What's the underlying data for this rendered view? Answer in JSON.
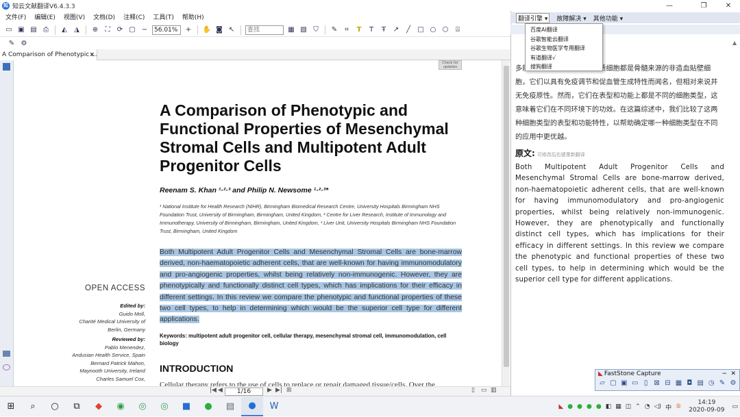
{
  "window": {
    "title": "知云文献翻译V6.4.3.3",
    "app_icon": "知"
  },
  "menu": [
    "文件(F)",
    "编辑(E)",
    "视图(V)",
    "文档(D)",
    "注释(C)",
    "工具(T)",
    "帮助(H)"
  ],
  "toolbar": {
    "zoom": "56.01%",
    "find_placeholder": "查找"
  },
  "tab": {
    "title": "A Comparison of Phenotypic ...",
    "close": "×"
  },
  "paper": {
    "badge": "Check for updates",
    "title": "A Comparison of Phenotypic and Functional Properties of Mesenchymal Stromal Cells and Multipotent Adult Progenitor Cells",
    "authors": "Reenam S. Khan ¹·²·³ and Philip N. Newsome ¹·²·³*",
    "affiliations": "¹ National Institute for Health Research (NIHR), Birmingham Biomedical Research Centre, University Hospitals Birmingham NHS Foundation Trust, University of Birmingham, Birmingham, United Kingdom, ² Centre for Liver Research, Institute of Immunology and Immunotherapy, University of Birmingham, Birmingham, United Kingdom, ³ Liver Unit, University Hospitals Birmingham NHS Foundation Trust, Birmingham, United Kingdom",
    "abstract": "Both Multipotent Adult Progenitor Cells and Mesenchymal Stromal Cells are bone-marrow derived, non-haematopoietic adherent cells, that are well-known for having immunomodulatory and pro-angiogenic properties, whilst being relatively non-immunogenic. However, they are phenotypically and functionally distinct cell types, which has implications for their efficacy in different settings. In this review we compare the phenotypic and functional properties of these two cell types, to help in determining which would be the superior cell type for different applications.",
    "keywords_label": "Keywords:",
    "keywords": "multipotent adult progenitor cell, cellular therapy, mesenchymal stromal cell, immunomodulation, cell biology",
    "intro_heading": "INTRODUCTION",
    "intro_text": "Cellular therapy refers to the use of cells to replace or repair damaged tissue/cells. Over the",
    "open_access": "OPEN ACCESS",
    "edited_by_label": "Edited by:",
    "edited_by": [
      "Guido Moll,",
      "Charité Medical University of",
      "Berlin, Germany"
    ],
    "reviewed_by_label": "Reviewed by:",
    "reviewed_by": [
      "Pablo Menendez,",
      "Andusian Health Service, Spain",
      "Bernard Patrick Mahon,",
      "Maynooth University, Ireland",
      "Charles Samuel Cox,"
    ]
  },
  "status": {
    "page": "1/16"
  },
  "right_panel": {
    "tabs": [
      "翻译引擎 ▾",
      "故障解决 ▾",
      "其他功能 ▾"
    ],
    "engine_menu": [
      "百度AI翻译",
      "谷歌智能云翻译",
      "谷歌生物医学专用翻译",
      "有道翻译√",
      "搜狗翻译"
    ],
    "translation": "多能成体祖细胞和间充质基质细胞都是骨髓来源的非造血贴壁细胞，它们以具有免疫调节和促血管生成特性而闻名，但相对来说并无免疫原性。然而，它们在表型和功能上都是不同的细胞类型，这意味着它们在不同环境下的功效。在这篇综述中，我们比较了这两种细胞类型的表型和功能特性，以帮助确定哪一种细胞类型在不同的应用中更优越。",
    "original_heading": "原文:",
    "original_hint": "可修改后右键重新翻译",
    "original": "Both Multipotent Adult Progenitor Cells and Mesenchymal Stromal Cells are bone-marrow derived, non-haematopoietic adherent cells, that are well-known for having immunomodulatory and pro-angiogenic properties, whilst being relatively non-immunogenic. However, they are phenotypically and functionally distinct cell types, which has implications for their efficacy in different settings. In this review we compare the phenotypic and functional properties of these two cell types, to help in determining which would be the superior cell type for different applications."
  },
  "capture": {
    "title": "FastStone Capture"
  },
  "taskbar": {
    "time": "14:19",
    "date": "2020-09-09",
    "ime": "中"
  },
  "colors": {
    "highlight": "#a9c7e4",
    "accent": "#3b7ad8"
  }
}
